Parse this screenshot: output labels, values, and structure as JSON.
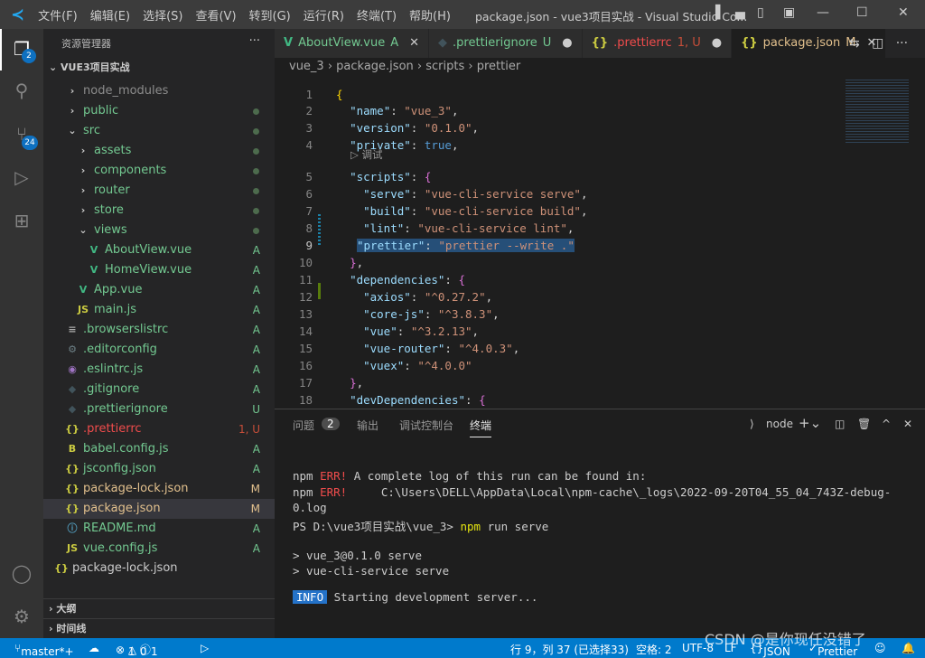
{
  "titlebar": {
    "menus": [
      "文件(F)",
      "编辑(E)",
      "选择(S)",
      "查看(V)",
      "转到(G)",
      "运行(R)",
      "终端(T)",
      "帮助(H)"
    ],
    "title": "package.json - vue3项目实战 - Visual Studio Co..."
  },
  "activity": {
    "explorer_badge": "2",
    "scm_badge": "24"
  },
  "sidebar": {
    "header": "资源管理器",
    "more": "···",
    "project": "VUE3项目实战",
    "items": [
      {
        "label": "node_modules",
        "icon": "chevron-right",
        "indent": 1,
        "color": "#8c8c8c",
        "status": ""
      },
      {
        "label": "public",
        "icon": "chevron-right",
        "indent": 1,
        "color": "#73c991",
        "status": "dot"
      },
      {
        "label": "src",
        "icon": "chevron-down",
        "indent": 1,
        "color": "#73c991",
        "status": "dot"
      },
      {
        "label": "assets",
        "icon": "chevron-right",
        "indent": 2,
        "color": "#73c991",
        "status": "dot"
      },
      {
        "label": "components",
        "icon": "chevron-right",
        "indent": 2,
        "color": "#73c991",
        "status": "dot"
      },
      {
        "label": "router",
        "icon": "chevron-right",
        "indent": 2,
        "color": "#73c991",
        "status": "dot"
      },
      {
        "label": "store",
        "icon": "chevron-right",
        "indent": 2,
        "color": "#73c991",
        "status": "dot"
      },
      {
        "label": "views",
        "icon": "chevron-down",
        "indent": 2,
        "color": "#73c991",
        "status": "dot"
      },
      {
        "label": "AboutView.vue",
        "icon": "vue",
        "indent": 3,
        "color": "#73c991",
        "status": "A"
      },
      {
        "label": "HomeView.vue",
        "icon": "vue",
        "indent": 3,
        "color": "#73c991",
        "status": "A"
      },
      {
        "label": "App.vue",
        "icon": "vue",
        "indent": 2,
        "color": "#73c991",
        "status": "A"
      },
      {
        "label": "main.js",
        "icon": "js",
        "indent": 2,
        "color": "#73c991",
        "status": "A"
      },
      {
        "label": ".browserslistrc",
        "icon": "lines",
        "indent": 1,
        "color": "#73c991",
        "status": "A"
      },
      {
        "label": ".editorconfig",
        "icon": "gear",
        "indent": 1,
        "color": "#73c991",
        "status": "A"
      },
      {
        "label": ".eslintrc.js",
        "icon": "eslint",
        "indent": 1,
        "color": "#73c991",
        "status": "A"
      },
      {
        "label": ".gitignore",
        "icon": "git",
        "indent": 1,
        "color": "#73c991",
        "status": "A"
      },
      {
        "label": ".prettierignore",
        "icon": "git",
        "indent": 1,
        "color": "#73c991",
        "status": "U"
      },
      {
        "label": ".prettierrc",
        "icon": "json",
        "indent": 1,
        "color": "#f14c4c",
        "status": "1, U"
      },
      {
        "label": "babel.config.js",
        "icon": "babel",
        "indent": 1,
        "color": "#73c991",
        "status": "A"
      },
      {
        "label": "jsconfig.json",
        "icon": "json",
        "indent": 1,
        "color": "#73c991",
        "status": "A"
      },
      {
        "label": "package-lock.json",
        "icon": "json",
        "indent": 1,
        "color": "#e2c08d",
        "status": "M"
      },
      {
        "label": "package.json",
        "icon": "json",
        "indent": 1,
        "color": "#e2c08d",
        "status": "M",
        "selected": true
      },
      {
        "label": "README.md",
        "icon": "info",
        "indent": 1,
        "color": "#73c991",
        "status": "A"
      },
      {
        "label": "vue.config.js",
        "icon": "js",
        "indent": 1,
        "color": "#73c991",
        "status": "A"
      },
      {
        "label": "package-lock.json",
        "icon": "json",
        "indent": 0,
        "color": "#ccc",
        "status": ""
      }
    ],
    "outline": "大纲",
    "timeline": "时间线"
  },
  "tabs": [
    {
      "label": "AboutView.vue",
      "status": "A",
      "icon": "vue",
      "color": "#73c991"
    },
    {
      "label": ".prettierignore",
      "status": "U",
      "icon": "git",
      "color": "#73c991",
      "dot": true
    },
    {
      "label": ".prettierrc",
      "status": "1, U",
      "icon": "json",
      "color": "#f14c4c",
      "dot": true
    },
    {
      "label": "package.json",
      "status": "M",
      "icon": "json",
      "color": "#e2c08d",
      "active": true
    }
  ],
  "breadcrumb": [
    "vue_3",
    "package.json",
    "scripts",
    "prettier"
  ],
  "editor": {
    "codelens": "调试",
    "lines": [
      [
        [
          "{",
          "y"
        ]
      ],
      [
        [
          "  "
        ],
        [
          "\"name\"",
          "k"
        ],
        [
          ": "
        ],
        [
          "\"vue_3\"",
          "s"
        ],
        [
          ","
        ]
      ],
      [
        [
          "  "
        ],
        [
          "\"version\"",
          "k"
        ],
        [
          ": "
        ],
        [
          "\"0.1.0\"",
          "s"
        ],
        [
          ","
        ]
      ],
      [
        [
          "  "
        ],
        [
          "\"private\"",
          "k"
        ],
        [
          ": "
        ],
        [
          "true",
          "b"
        ],
        [
          ","
        ]
      ],
      [
        [
          "  "
        ],
        [
          "\"scripts\"",
          "k"
        ],
        [
          ": "
        ],
        [
          "{",
          "p"
        ]
      ],
      [
        [
          "    "
        ],
        [
          "\"serve\"",
          "k"
        ],
        [
          ": "
        ],
        [
          "\"vue-cli-service serve\"",
          "s"
        ],
        [
          ","
        ]
      ],
      [
        [
          "    "
        ],
        [
          "\"build\"",
          "k"
        ],
        [
          ": "
        ],
        [
          "\"vue-cli-service build\"",
          "s"
        ],
        [
          ","
        ]
      ],
      [
        [
          "    "
        ],
        [
          "\"lint\"",
          "k"
        ],
        [
          ": "
        ],
        [
          "\"vue-cli-service lint\"",
          "s"
        ],
        [
          ","
        ]
      ],
      [
        [
          "    "
        ],
        [
          "\"prettier\"",
          "k"
        ],
        [
          ": "
        ],
        [
          "\"prettier --write .\"",
          "s"
        ]
      ],
      [
        [
          "  "
        ],
        [
          "}",
          "p"
        ],
        [
          ","
        ]
      ],
      [
        [
          "  "
        ],
        [
          "\"dependencies\"",
          "k"
        ],
        [
          ": "
        ],
        [
          "{",
          "p"
        ]
      ],
      [
        [
          "    "
        ],
        [
          "\"axios\"",
          "k"
        ],
        [
          ": "
        ],
        [
          "\"^0.27.2\"",
          "s"
        ],
        [
          ","
        ]
      ],
      [
        [
          "    "
        ],
        [
          "\"core-js\"",
          "k"
        ],
        [
          ": "
        ],
        [
          "\"^3.8.3\"",
          "s"
        ],
        [
          ","
        ]
      ],
      [
        [
          "    "
        ],
        [
          "\"vue\"",
          "k"
        ],
        [
          ": "
        ],
        [
          "\"^3.2.13\"",
          "s"
        ],
        [
          ","
        ]
      ],
      [
        [
          "    "
        ],
        [
          "\"vue-router\"",
          "k"
        ],
        [
          ": "
        ],
        [
          "\"^4.0.3\"",
          "s"
        ],
        [
          ","
        ]
      ],
      [
        [
          "    "
        ],
        [
          "\"vuex\"",
          "k"
        ],
        [
          ": "
        ],
        [
          "\"^4.0.0\"",
          "s"
        ]
      ],
      [
        [
          "  "
        ],
        [
          "}",
          "p"
        ],
        [
          ","
        ]
      ],
      [
        [
          "  "
        ],
        [
          "\"devDependencies\"",
          "k"
        ],
        [
          ": "
        ],
        [
          "{",
          "p"
        ]
      ]
    ]
  },
  "panel": {
    "tabs": [
      "问题",
      "输出",
      "调试控制台",
      "终端"
    ],
    "problems_count": "2",
    "active_tab": "终端",
    "terminal_name": "node",
    "terminal": [
      "npm ERR! A complete log of this run can be found in:",
      "npm ERR!     C:\\Users\\DELL\\AppData\\Local\\npm-cache\\_logs\\2022-09-20T04_55_04_743Z-debug-",
      "0.log",
      "PS D:\\vue3项目实战\\vue_3> npm run serve",
      "",
      "> vue_3@0.1.0 serve",
      "> vue-cli-service serve",
      ""
    ],
    "info_badge": "INFO",
    "info_text": "Starting development server..."
  },
  "status": {
    "branch": "master*+",
    "errors": "1",
    "warnings": "0",
    "infos": "1",
    "position": "行 9，列 37 (已选择33)",
    "spaces": "空格: 2",
    "encoding": "UTF-8",
    "eol": "LF",
    "language": "JSON",
    "formatter": "Prettier"
  },
  "watermark": "CSDN @是你现任没错了"
}
